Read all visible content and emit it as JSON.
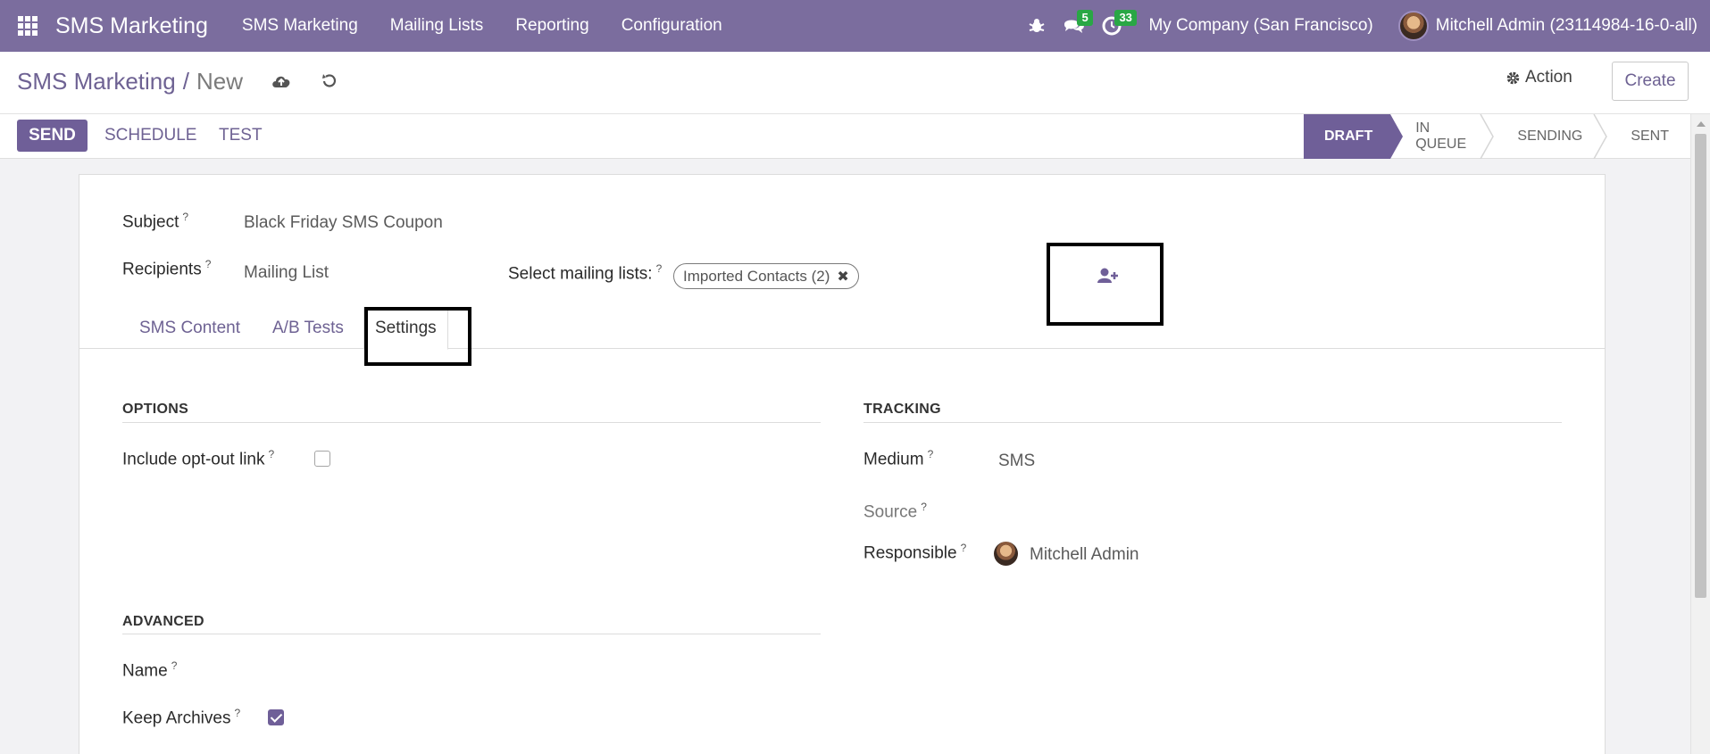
{
  "navbar": {
    "brand": "SMS Marketing",
    "menu": [
      "SMS Marketing",
      "Mailing Lists",
      "Reporting",
      "Configuration"
    ],
    "messages_count": "5",
    "activities_count": "33",
    "company": "My Company (San Francisco)",
    "user": "Mitchell Admin (23114984-16-0-all)"
  },
  "control": {
    "breadcrumb_parent": "SMS Marketing",
    "breadcrumb_sep": "/",
    "breadcrumb_current": "New",
    "action_label": "Action",
    "create_label": "Create"
  },
  "statusbar": {
    "send_label": "SEND",
    "schedule_label": "SCHEDULE",
    "test_label": "TEST",
    "stages": [
      "DRAFT",
      "IN QUEUE",
      "SENDING",
      "SENT"
    ],
    "active_stage": "DRAFT"
  },
  "form": {
    "subject_label": "Subject",
    "subject_value": "Black Friday SMS Coupon",
    "recipients_label": "Recipients",
    "recipients_value": "Mailing List",
    "mailing_lists_label": "Select mailing lists:",
    "mailing_list_tag": "Imported Contacts (2)",
    "tooltip_mark": "?",
    "tabs": [
      "SMS Content",
      "A/B Tests",
      "Settings"
    ],
    "active_tab": "Settings"
  },
  "settings": {
    "options_title": "OPTIONS",
    "optout_label": "Include opt-out link",
    "optout_checked": false,
    "tracking_title": "TRACKING",
    "medium_label": "Medium",
    "medium_value": "SMS",
    "source_label": "Source",
    "responsible_label": "Responsible",
    "responsible_value": "Mitchell Admin",
    "advanced_title": "ADVANCED",
    "name_label": "Name",
    "keep_archives_label": "Keep Archives",
    "keep_archives_checked": true
  },
  "colors": {
    "navbar": "#7b6d9e",
    "primary": "#6f5f98",
    "link": "#6e6293",
    "badge": "#29a745"
  }
}
